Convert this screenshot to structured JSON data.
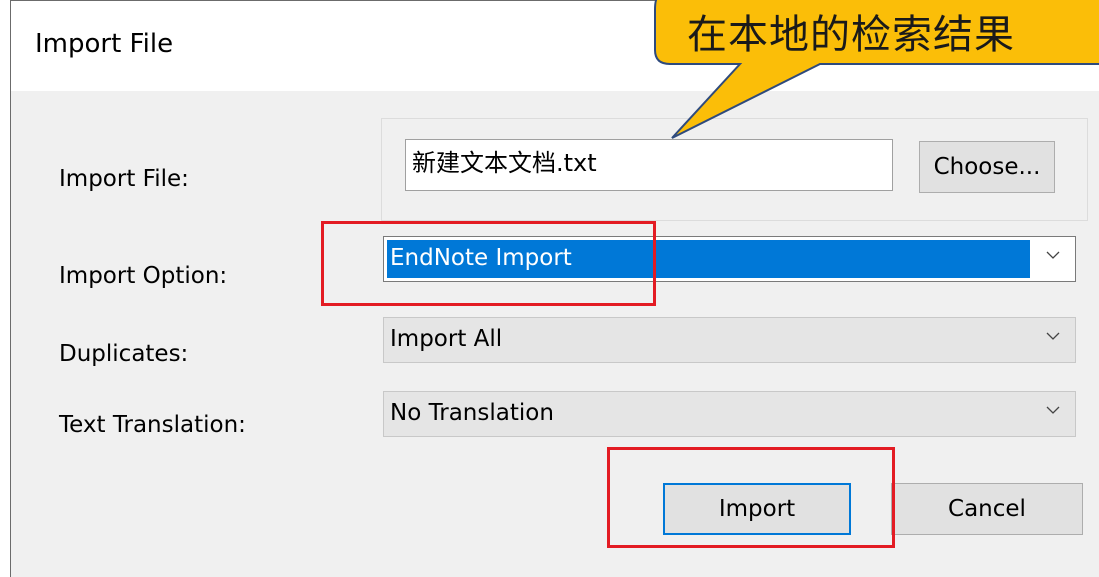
{
  "dialog": {
    "title": "Import File",
    "title_controls": [
      "?",
      "×"
    ]
  },
  "form": {
    "import_file_label": "Import File:",
    "import_file_value": "新建文本文档.txt",
    "choose_label": "Choose...",
    "import_option_label": "Import Option:",
    "import_option_value": "EndNote Import",
    "duplicates_label": "Duplicates:",
    "duplicates_value": "Import All",
    "text_translation_label": "Text Translation:",
    "text_translation_value": "No Translation"
  },
  "buttons": {
    "import": "Import",
    "cancel": "Cancel"
  },
  "callout": {
    "text": "在本地的检索结果"
  },
  "colors": {
    "callout_fill": "#fbbe08",
    "callout_border": "#2e4a7d",
    "highlight_box": "#e31b23",
    "selection": "#0078d7"
  }
}
